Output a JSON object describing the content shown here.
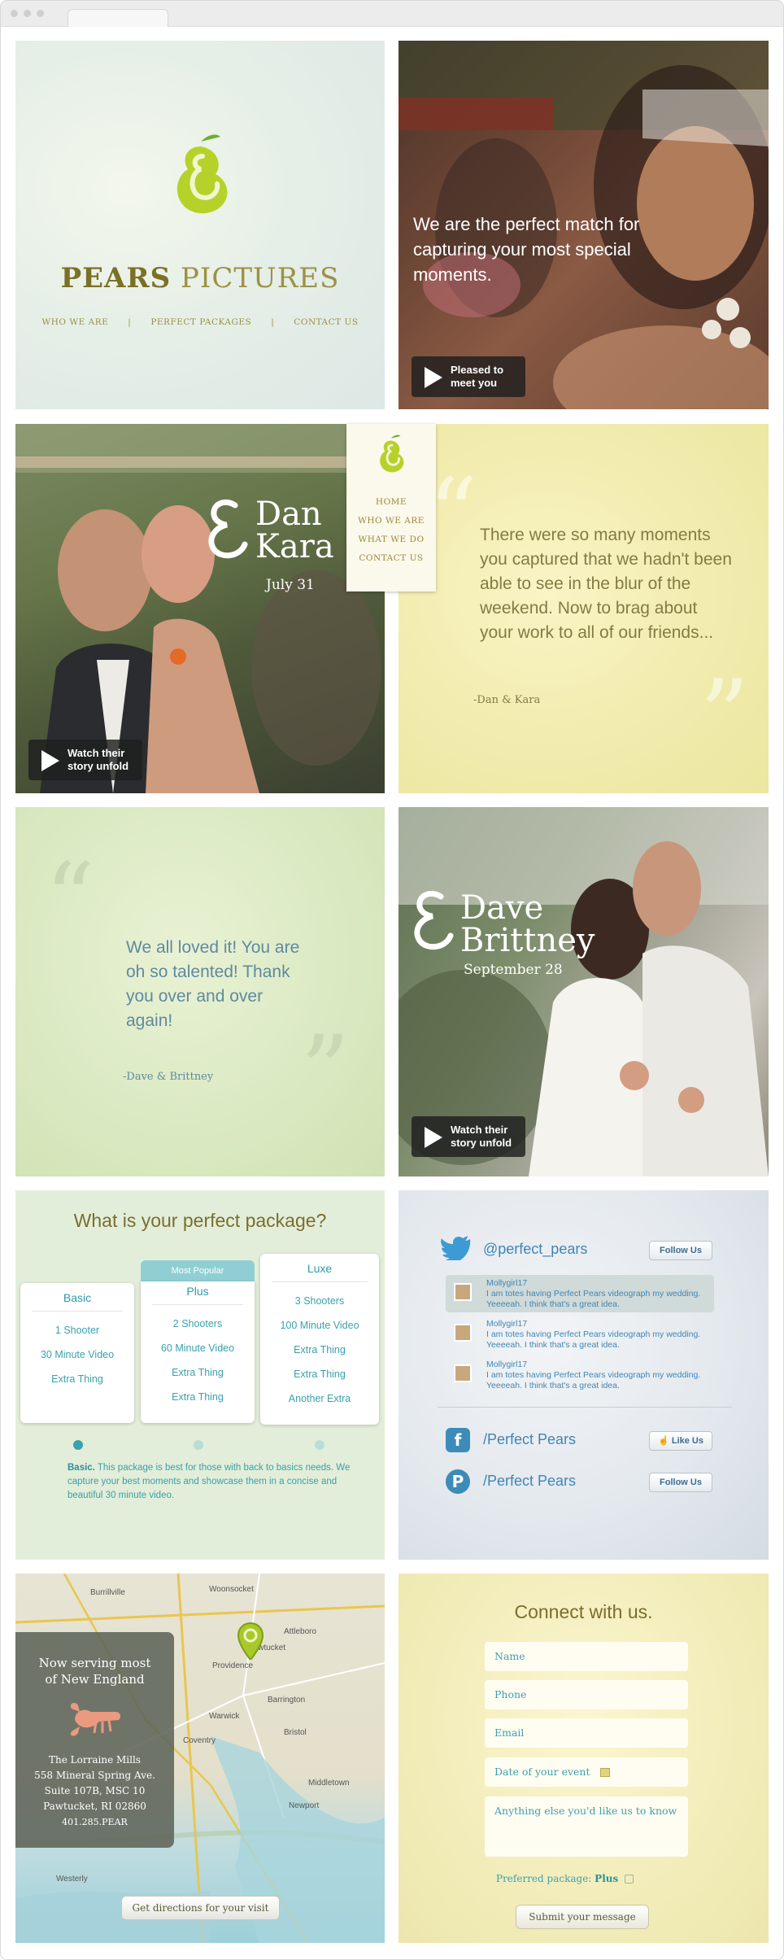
{
  "brand": {
    "name_bold": "PEARS",
    "name_rest": "PICTURES",
    "nav": [
      "WHO WE ARE",
      "|",
      "PERFECT PACKAGES",
      "|",
      "CONTACT US"
    ]
  },
  "hero": {
    "tagline": "We are the perfect match for capturing your most special moments.",
    "cta": "Pleased to meet you"
  },
  "side_nav": [
    "HOME",
    "WHO WE ARE",
    "WHAT WE DO",
    "CONTACT US"
  ],
  "couple1": {
    "ampersand": "&",
    "name_line1": "Dan",
    "name_line2": "Kara",
    "date": "July 31",
    "cta": "Watch their story unfold"
  },
  "quote1": {
    "text": "There were so many moments you captured that we hadn't been able to see in the blur of the weekend. Now to brag about your work to all of our friends...",
    "author": "-Dan & Kara",
    "open_mark": "“",
    "close_mark": "”"
  },
  "quote2": {
    "text": "We all loved it! You are oh so talented! Thank you over and over again!",
    "author": "-Dave & Brittney",
    "open_mark": "“",
    "close_mark": "”"
  },
  "couple2": {
    "ampersand": "&",
    "name_line1": "Dave",
    "name_line2": "Brittney",
    "date": "September 28",
    "cta": "Watch their story unfold"
  },
  "packages": {
    "title": "What is your perfect package?",
    "popular_label": "Most Popular",
    "plans": [
      {
        "name": "Basic",
        "features": [
          "1 Shooter",
          "30 Minute Video",
          "Extra Thing"
        ]
      },
      {
        "name": "Plus",
        "features": [
          "2 Shooters",
          "60 Minute Video",
          "Extra Thing",
          "Extra Thing"
        ]
      },
      {
        "name": "Luxe",
        "features": [
          "3 Shooters",
          "100 Minute Video",
          "Extra Thing",
          "Extra Thing",
          "Another Extra"
        ]
      }
    ],
    "selected_index": 0,
    "desc_label": "Basic.",
    "desc_text": "This package is best for those with back to basics needs. We capture your best moments and showcase them in a concise and beautiful 30 minute video."
  },
  "social": {
    "twitter_handle": "@perfect_pears",
    "twitter_follow": "Follow Us",
    "tweets": [
      {
        "user": "Mollygirl17",
        "text": "I am totes having Perfect Pears videograph my wedding. Yeeeeah. I think that's a great idea."
      },
      {
        "user": "Mollygirl17",
        "text": "I am totes having Perfect Pears videograph my wedding. Yeeeeah. I think that's a great idea."
      },
      {
        "user": "Mollygirl17",
        "text": "I am totes having Perfect Pears videograph my wedding. Yeeeeah. I think that's a great idea."
      }
    ],
    "facebook_name": "/Perfect Pears",
    "facebook_like": "Like Us",
    "pinterest_name": "/Perfect Pears",
    "pinterest_follow": "Follow Us",
    "icons": {
      "facebook": "f",
      "pinterest": "P"
    }
  },
  "map": {
    "serving_line1": "Now serving most",
    "serving_line2": "of New England",
    "address": [
      "The Lorraine Mills",
      "558 Mineral Spring Ave.",
      "Suite 107B, MSC 10",
      "Pawtucket, RI 02860",
      "401.285.PEAR"
    ],
    "directions_button": "Get directions for your visit",
    "labels": [
      "Burrillville",
      "Woonsocket",
      "Attleboro",
      "Providence",
      "Pawtucket",
      "Warwick",
      "Coventry",
      "Barrington",
      "Bristol",
      "Middletown",
      "Newport",
      "Westerly"
    ]
  },
  "connect": {
    "title": "Connect with us.",
    "fields": [
      "Name",
      "Phone",
      "Email",
      "Date of your event"
    ],
    "message_placeholder": "Anything else you'd like us to know",
    "preferred_label": "Preferred package:",
    "preferred_value": "Plus",
    "submit": "Submit your message"
  },
  "colors": {
    "accent_teal": "#3aa1ad",
    "olive": "#7a6e2e",
    "pear_green": "#9cc12c",
    "twitter_blue": "#3f86b5"
  }
}
